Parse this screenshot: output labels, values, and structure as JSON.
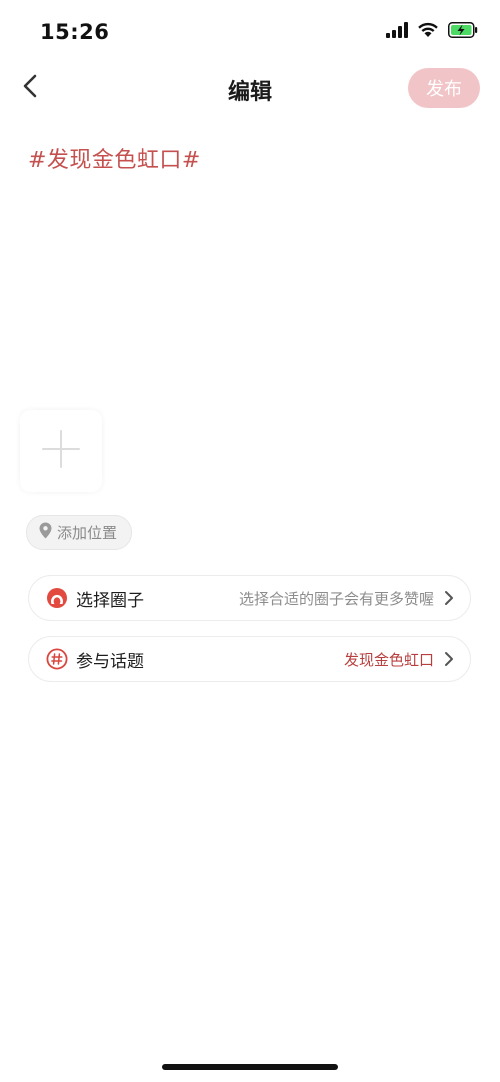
{
  "status_bar": {
    "time": "15:26",
    "icons": [
      "signal-icon",
      "wifi-icon",
      "battery-charging-icon"
    ]
  },
  "nav": {
    "title": "编辑",
    "publish_label": "发布",
    "back_icon": "chevron-left-icon"
  },
  "post": {
    "text": "#发现金色虹口#"
  },
  "media": {
    "add_icon": "plus-icon"
  },
  "location": {
    "label": "添加位置",
    "icon": "location-pin-icon"
  },
  "options": [
    {
      "label": "选择圈子",
      "value": "选择合适的圈子会有更多赞喔",
      "icon": "circle-icon"
    },
    {
      "label": "参与话题",
      "value": "发现金色虹口",
      "icon": "hashtag-icon"
    }
  ],
  "colors": {
    "accent": "#c4514f",
    "publish_bg": "#f1c5c7",
    "battery": "#4cd964"
  }
}
